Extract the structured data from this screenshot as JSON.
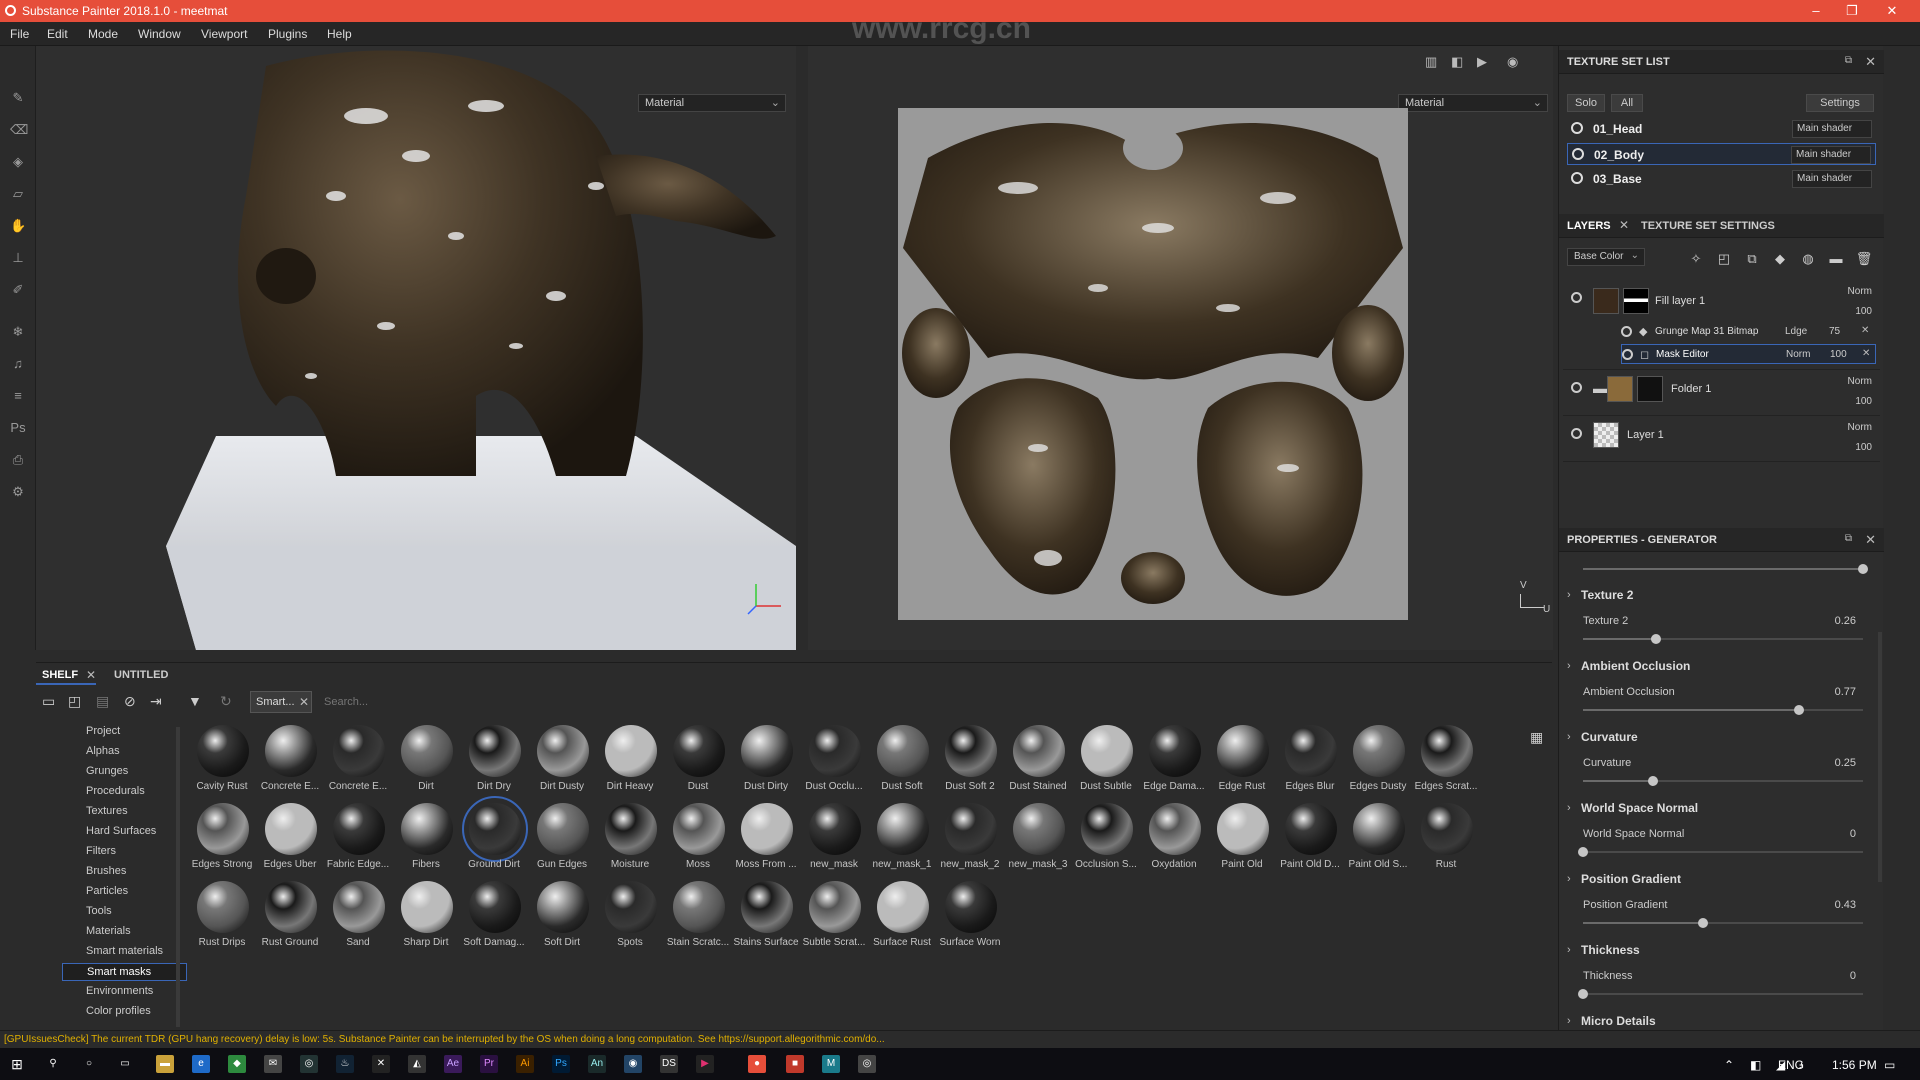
{
  "window": {
    "title": "Substance Painter 2018.1.0 - meetmat"
  },
  "menu": [
    "File",
    "Edit",
    "Mode",
    "Window",
    "Viewport",
    "Plugins",
    "Help"
  ],
  "viewport": {
    "left_select": "Material",
    "right_select": "Material",
    "axis_v": "V",
    "axis_u": "U"
  },
  "texture_set_list": {
    "title": "TEXTURE SET LIST",
    "solo": "Solo",
    "all": "All",
    "settings": "Settings",
    "sets": [
      {
        "name": "01_Head",
        "shader": "Main shader"
      },
      {
        "name": "02_Body",
        "shader": "Main shader"
      },
      {
        "name": "03_Base",
        "shader": "Main shader"
      }
    ]
  },
  "layers": {
    "tab_layers": "LAYERS",
    "tab_settings": "TEXTURE SET SETTINGS",
    "channel": "Base Color",
    "items": [
      {
        "name": "Fill layer 1",
        "blend": "Norm",
        "opacity": "100"
      },
      {
        "name": "Grunge Map 31 Bitmap",
        "blend": "Ldge",
        "opacity": "75"
      },
      {
        "name": "Mask Editor",
        "blend": "Norm",
        "opacity": "100"
      },
      {
        "name": "Folder 1",
        "blend": "Norm",
        "opacity": "100"
      },
      {
        "name": "Layer 1",
        "blend": "Norm",
        "opacity": "100"
      }
    ]
  },
  "properties": {
    "title": "PROPERTIES - GENERATOR",
    "top_slider": 1.0,
    "sections": [
      {
        "header": "Texture 2",
        "label": "Texture 2",
        "value": "0.26",
        "level": 0.26
      },
      {
        "header": "Ambient Occlusion",
        "label": "Ambient Occlusion",
        "value": "0.77",
        "level": 0.77
      },
      {
        "header": "Curvature",
        "label": "Curvature",
        "value": "0.25",
        "level": 0.25
      },
      {
        "header": "World Space Normal",
        "label": "World Space Normal",
        "value": "0",
        "level": 0
      },
      {
        "header": "Position Gradient",
        "label": "Position Gradient",
        "value": "0.43",
        "level": 0.43
      },
      {
        "header": "Thickness",
        "label": "Thickness",
        "value": "0",
        "level": 0
      }
    ],
    "last_header": "Micro Details"
  },
  "shelf": {
    "tab_shelf": "SHELF",
    "tab_untitled": "UNTITLED",
    "filter_chip": "Smart...",
    "search_placeholder": "Search...",
    "categories": [
      "Project",
      "Alphas",
      "Grunges",
      "Procedurals",
      "Textures",
      "Hard Surfaces",
      "Filters",
      "Brushes",
      "Particles",
      "Tools",
      "Materials",
      "Smart materials",
      "Smart masks",
      "Environments",
      "Color profiles"
    ],
    "active_category": "Smart masks",
    "items": [
      "Cavity Rust",
      "Concrete E...",
      "Concrete E...",
      "Dirt",
      "Dirt Dry",
      "Dirt Dusty",
      "Dirt Heavy",
      "Dust",
      "Dust Dirty",
      "Dust Occlu...",
      "Dust Soft",
      "Dust Soft 2",
      "Dust Stained",
      "Dust Subtle",
      "Edge Dama...",
      "Edge Rust",
      "Edges Blur",
      "Edges Dusty",
      "Edges Scrat...",
      "Edges Strong",
      "Edges Uber",
      "Fabric Edge...",
      "Fibers",
      "Ground Dirt",
      "Gun Edges",
      "Moisture",
      "Moss",
      "Moss From ...",
      "new_mask",
      "new_mask_1",
      "new_mask_2",
      "new_mask_3",
      "Occlusion S...",
      "Oxydation",
      "Paint Old",
      "Paint Old D...",
      "Paint Old S...",
      "Rust",
      "Rust Drips",
      "Rust Ground",
      "Sand",
      "Sharp Dirt",
      "Soft Damag...",
      "Soft Dirt",
      "Spots",
      "Stain Scratc...",
      "Stains Surface",
      "Subtle Scrat...",
      "Surface Rust",
      "Surface Worn"
    ],
    "active_item": "Ground Dirt"
  },
  "status": {
    "message": "[GPUIssuesCheck] The current TDR (GPU hang recovery) delay is low: 5s. Substance Painter can be interrupted by the OS when doing a long computation. See https://support.allegorithmic.com/do..."
  },
  "taskbar": {
    "lang": "ENG",
    "time": "1:56 PM"
  },
  "watermark": "www.rrcg.cn"
}
